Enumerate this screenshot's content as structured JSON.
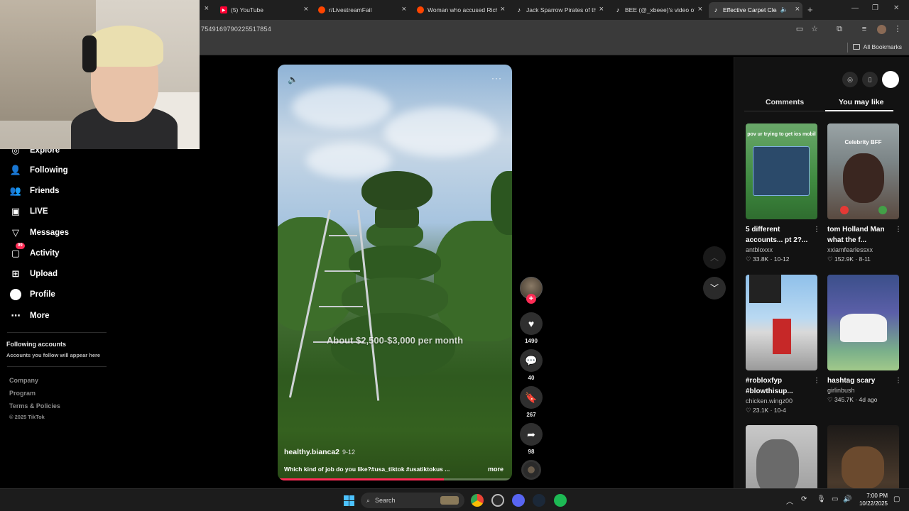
{
  "browser": {
    "tabs": [
      {
        "title": "(5) YouTube",
        "icon": "youtube-icon",
        "active": false
      },
      {
        "title": "r/LivestreamFail",
        "icon": "reddit-icon",
        "active": false
      },
      {
        "title": "Woman who accused Rich",
        "icon": "reddit-icon",
        "active": false
      },
      {
        "title": "Jack Sparrow Pirates of th",
        "icon": "tiktok-icon",
        "active": false
      },
      {
        "title": "BEE (@_xbeee)'s video of",
        "icon": "tiktok-icon",
        "active": false
      },
      {
        "title": "Effective Carpet Clean",
        "icon": "tiktok-icon",
        "active": true
      }
    ],
    "url": "7549169790225517854",
    "bookmarks_label": "All Bookmarks"
  },
  "nav": {
    "items": [
      {
        "label": "Explore",
        "icon": "compass-icon"
      },
      {
        "label": "Following",
        "icon": "following-icon"
      },
      {
        "label": "Friends",
        "icon": "friends-icon"
      },
      {
        "label": "LIVE",
        "icon": "live-icon"
      },
      {
        "label": "Messages",
        "icon": "messages-icon"
      },
      {
        "label": "Activity",
        "icon": "activity-icon",
        "badge": "99"
      },
      {
        "label": "Upload",
        "icon": "upload-icon"
      },
      {
        "label": "Profile",
        "icon": "profile-icon"
      },
      {
        "label": "More",
        "icon": "more-icon"
      }
    ],
    "following_title": "Following accounts",
    "following_sub": "Accounts you follow will appear here",
    "footer": [
      "Company",
      "Program",
      "Terms & Policies"
    ],
    "copyright": "© 2025 TikTok"
  },
  "video": {
    "caption": "About $2,500-$3,000 per month",
    "username": "healthy.bianca2",
    "date": "9-12",
    "description": "Which kind of job do you like?#usa_tiktok #usatiktokus ...",
    "more_label": "more",
    "progress": 0.71
  },
  "actions": {
    "likes": "1490",
    "comments": "40",
    "saves": "267",
    "shares": "98"
  },
  "panel": {
    "tab_comments": "Comments",
    "tab_like": "You may like",
    "cards": [
      {
        "title": "5 different accounts... pt 2?...",
        "author": "antbloxxx",
        "views": "33.8K",
        "date": "10-12",
        "thumb_text": "pov ur trying to get ios mobil"
      },
      {
        "title": "tom Holland Man what the f...",
        "author": "xxiamfearlessxx",
        "views": "152.9K",
        "date": "8-11",
        "thumb_text": "Celebrity BFF"
      },
      {
        "title": "#robloxfyp #blowthisup...",
        "author": "chicken.wingz00",
        "views": "23.1K",
        "date": "10-4",
        "thumb_text": ""
      },
      {
        "title": "hashtag scary",
        "author": "girlinbush",
        "views": "345.7K",
        "date": "4d ago",
        "thumb_text": ""
      },
      {
        "title": "",
        "author": "",
        "views": "",
        "date": "",
        "thumb_text": ""
      },
      {
        "title": "",
        "author": "",
        "views": "",
        "date": "",
        "thumb_text": ""
      }
    ]
  },
  "taskbar": {
    "search_label": "Search",
    "time": "7:00 PM",
    "date": "10/22/2025"
  },
  "colors": {
    "accent": "#fe2c55",
    "background": "#000000",
    "panel": "#121212"
  }
}
